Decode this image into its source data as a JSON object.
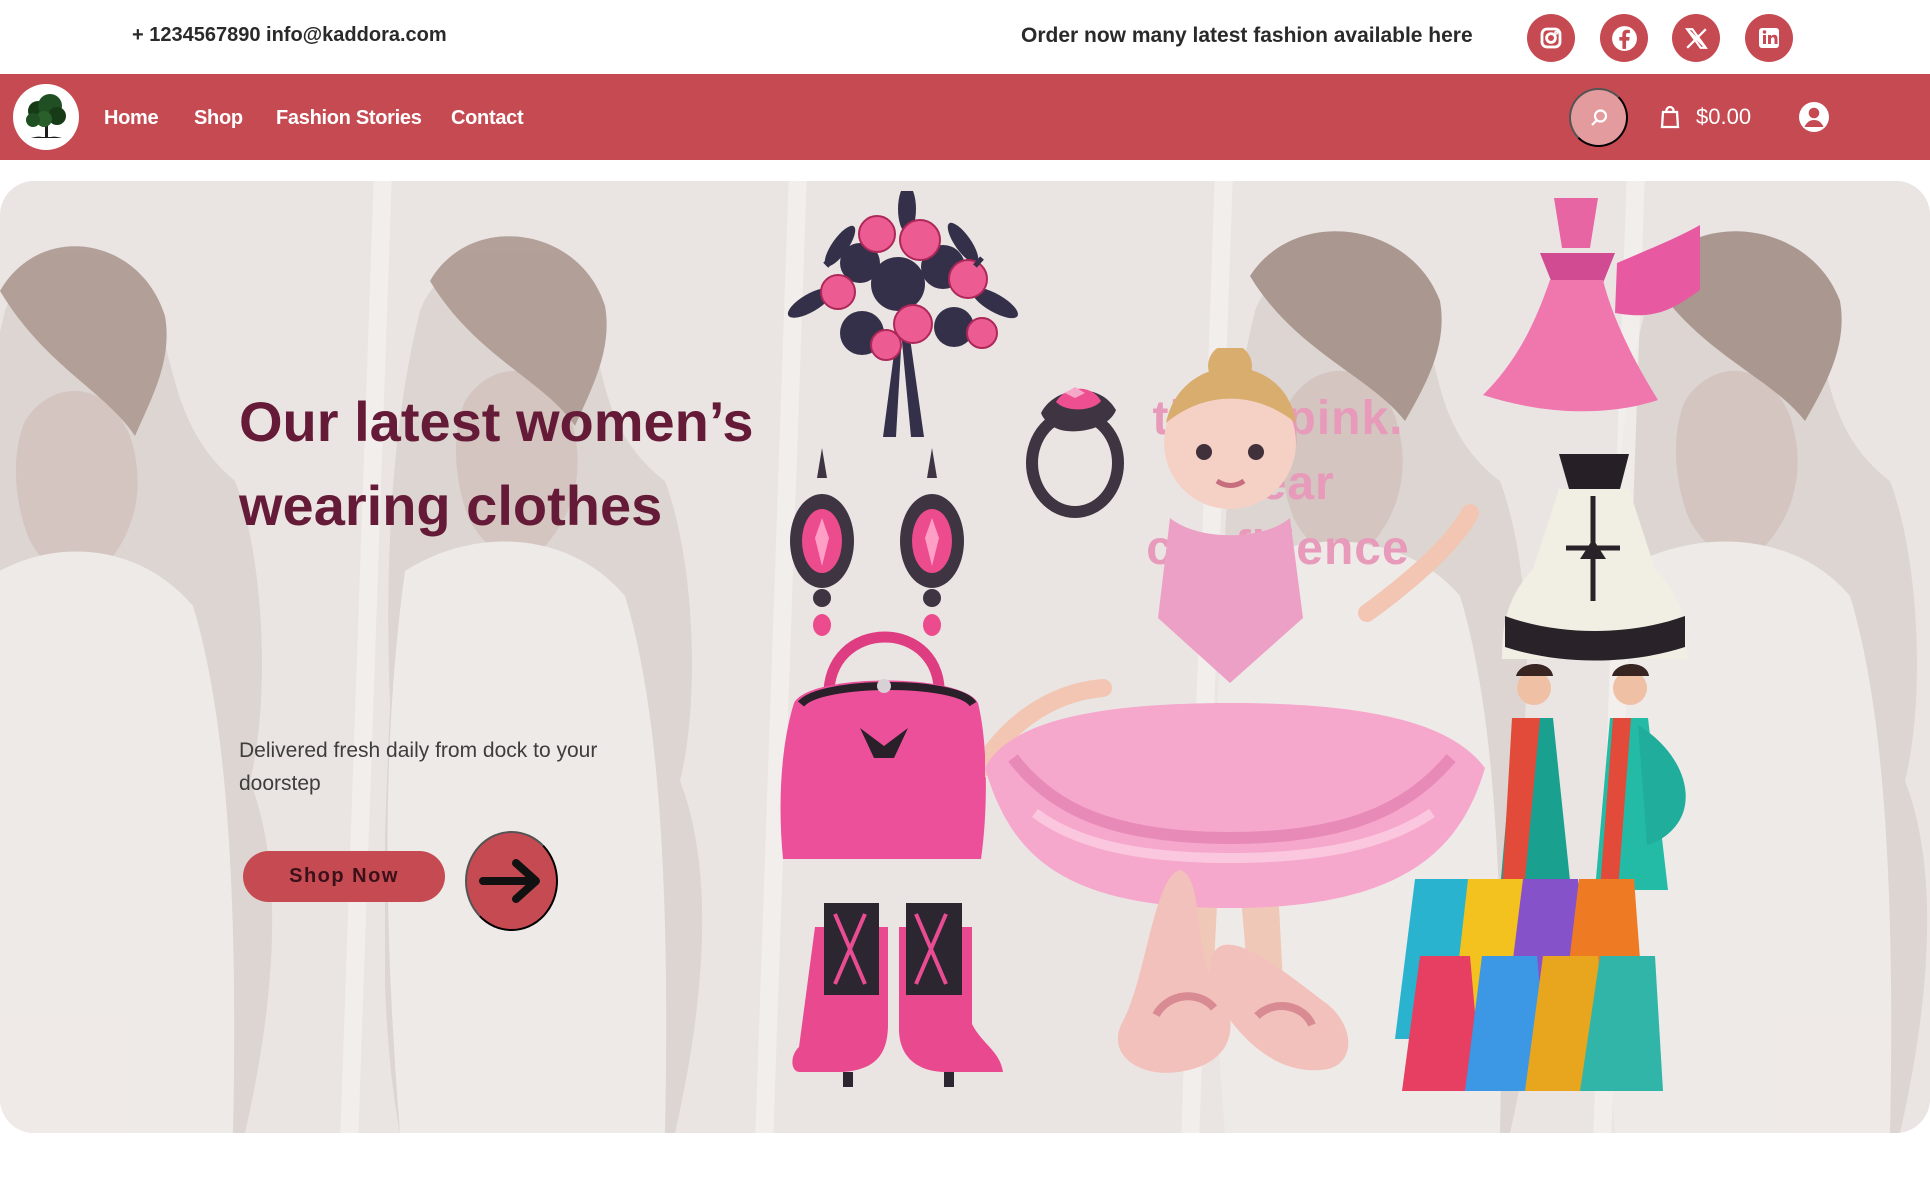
{
  "topbar": {
    "contact": "+ 1234567890 info@kaddora.com",
    "tagline": "Order now many latest fashion available here"
  },
  "social": [
    {
      "name": "instagram-icon"
    },
    {
      "name": "facebook-icon"
    },
    {
      "name": "x-twitter-icon"
    },
    {
      "name": "linkedin-icon"
    }
  ],
  "nav": {
    "items": [
      {
        "label": "Home"
      },
      {
        "label": "Shop"
      },
      {
        "label": "Fashion Stories"
      },
      {
        "label": "Contact"
      }
    ],
    "cart_total": "$0.00"
  },
  "hero": {
    "heading": "Our latest women’s wearing clothes",
    "subtitle": "Delivered fresh daily from dock to your doorstep",
    "button": "Shop Now",
    "slogan_line1": "think pink.",
    "slogan_line2": "wear confidence"
  },
  "colors": {
    "brand": "#c64a52",
    "heading": "#651b37",
    "slogan": "#e79aba"
  }
}
